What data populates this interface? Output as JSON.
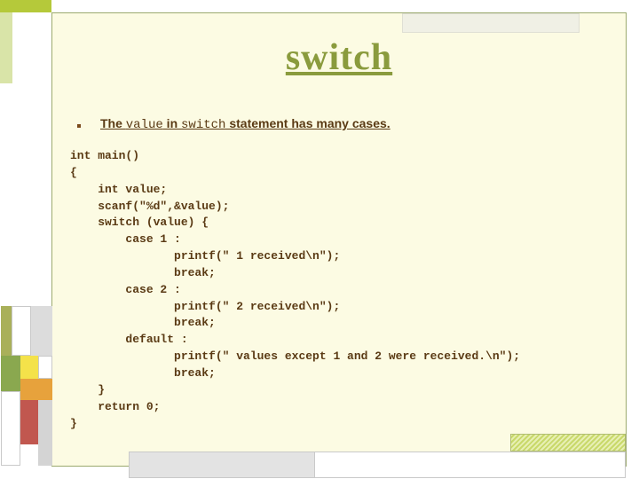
{
  "title": "switch",
  "bullet": {
    "prefix": "The ",
    "kw1": "value",
    "mid": " in ",
    "kw2": "switch",
    "suffix": " statement has many cases."
  },
  "code": {
    "l1": "int main()",
    "l2": "{",
    "l3": "    int value;",
    "l4": "    scanf(\"%d\",&value);",
    "l5": "    switch (value) {",
    "l6": "        case 1 :",
    "l7": "               printf(\" 1 received\\n\");",
    "l8": "               break;",
    "l9": "        case 2 :",
    "l10": "               printf(\" 2 received\\n\");",
    "l11": "               break;",
    "l12": "        default :",
    "l13": "               printf(\" values except 1 and 2 were received.\\n\");",
    "l14": "               break;",
    "l15": "    }",
    "l16": "    return 0;",
    "l17": "}"
  }
}
